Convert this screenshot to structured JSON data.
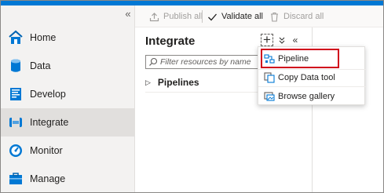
{
  "nav": {
    "collapse_glyph": "«",
    "items": [
      {
        "label": "Home",
        "icon": "home-icon"
      },
      {
        "label": "Data",
        "icon": "database-icon"
      },
      {
        "label": "Develop",
        "icon": "develop-icon"
      },
      {
        "label": "Integrate",
        "icon": "integrate-icon",
        "active": true
      },
      {
        "label": "Monitor",
        "icon": "monitor-icon"
      },
      {
        "label": "Manage",
        "icon": "manage-icon"
      }
    ]
  },
  "toolbar": {
    "publish_all": "Publish all",
    "validate_all": "Validate all",
    "discard_all": "Discard all"
  },
  "pane": {
    "title": "Integrate",
    "add_glyph": "+",
    "expand_glyph": "»",
    "collapse_glyph": "«",
    "filter_placeholder": "Filter resources by name",
    "tree": [
      {
        "label": "Pipelines",
        "chevron": "▷"
      }
    ]
  },
  "menu": {
    "items": [
      {
        "label": "Pipeline",
        "icon": "pipeline-icon"
      },
      {
        "label": "Copy Data tool",
        "icon": "copy-data-icon"
      },
      {
        "label": "Browse gallery",
        "icon": "gallery-icon"
      }
    ]
  },
  "colors": {
    "accent": "#0078d4",
    "highlight": "#d0021b",
    "nav_background": "#f3f2f1",
    "active_item": "#e1dfdd"
  }
}
